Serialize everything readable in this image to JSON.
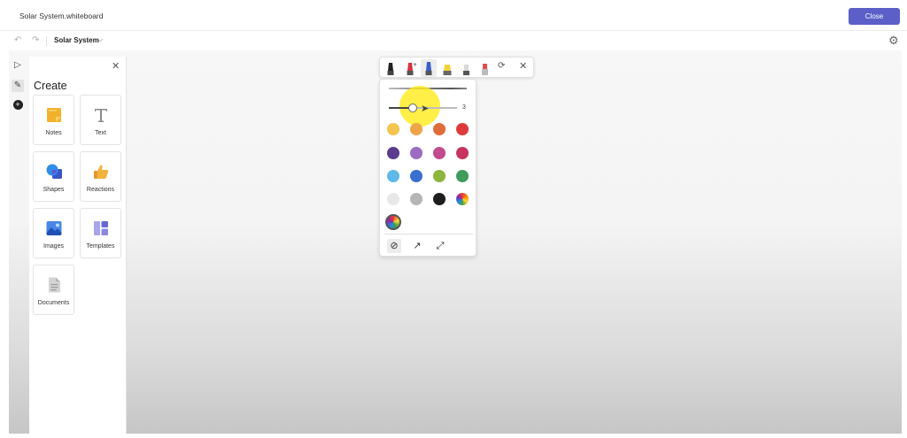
{
  "window": {
    "title": "Solar System.whiteboard",
    "close_label": "Close"
  },
  "subbar": {
    "undo_glyph": "↶",
    "redo_glyph": "↷",
    "board_name": "Solar System",
    "chevron": "⌵",
    "settings_glyph": "⚙"
  },
  "left_tools": {
    "select_glyph": "▷",
    "pen_glyph": "✎",
    "add_glyph": "+"
  },
  "create_panel": {
    "close_glyph": "✕",
    "title": "Create",
    "items": [
      {
        "label": "Notes",
        "icon": "sticky-note-icon"
      },
      {
        "label": "Text",
        "icon": "text-icon"
      },
      {
        "label": "Shapes",
        "icon": "shapes-icon"
      },
      {
        "label": "Reactions",
        "icon": "thumbs-up-icon"
      },
      {
        "label": "Images",
        "icon": "image-icon"
      },
      {
        "label": "Templates",
        "icon": "templates-icon"
      },
      {
        "label": "Documents",
        "icon": "document-icon"
      }
    ]
  },
  "ink_toolbar": {
    "tools": [
      "black-pen-icon",
      "red-pen-icon",
      "blue-pen-icon",
      "yellow-highlighter-icon",
      "eraser-icon",
      "red-eraser-icon"
    ],
    "selected_tool": "blue-pen-icon",
    "lasso_glyph": "⟳",
    "close_glyph": "✕"
  },
  "pen_options": {
    "size": "3",
    "size_fraction": 0.35,
    "colors": [
      "#f3c54e",
      "#efa44a",
      "#e06c3c",
      "#dd3b3b",
      "#5a3b8e",
      "#9b6cc1",
      "#c24a8e",
      "#c7335f",
      "#5fb8ea",
      "#3b6fd0",
      "#8cb63c",
      "#3f9c5c",
      "#e7e7e7",
      "#b5b5b5",
      "#1e1e1e",
      "rainbow"
    ],
    "arrow_options": [
      {
        "name": "no-arrow",
        "glyph": "⊘"
      },
      {
        "name": "single-arrow",
        "glyph": "↗"
      },
      {
        "name": "double-arrow",
        "glyph": "⤢"
      }
    ]
  }
}
